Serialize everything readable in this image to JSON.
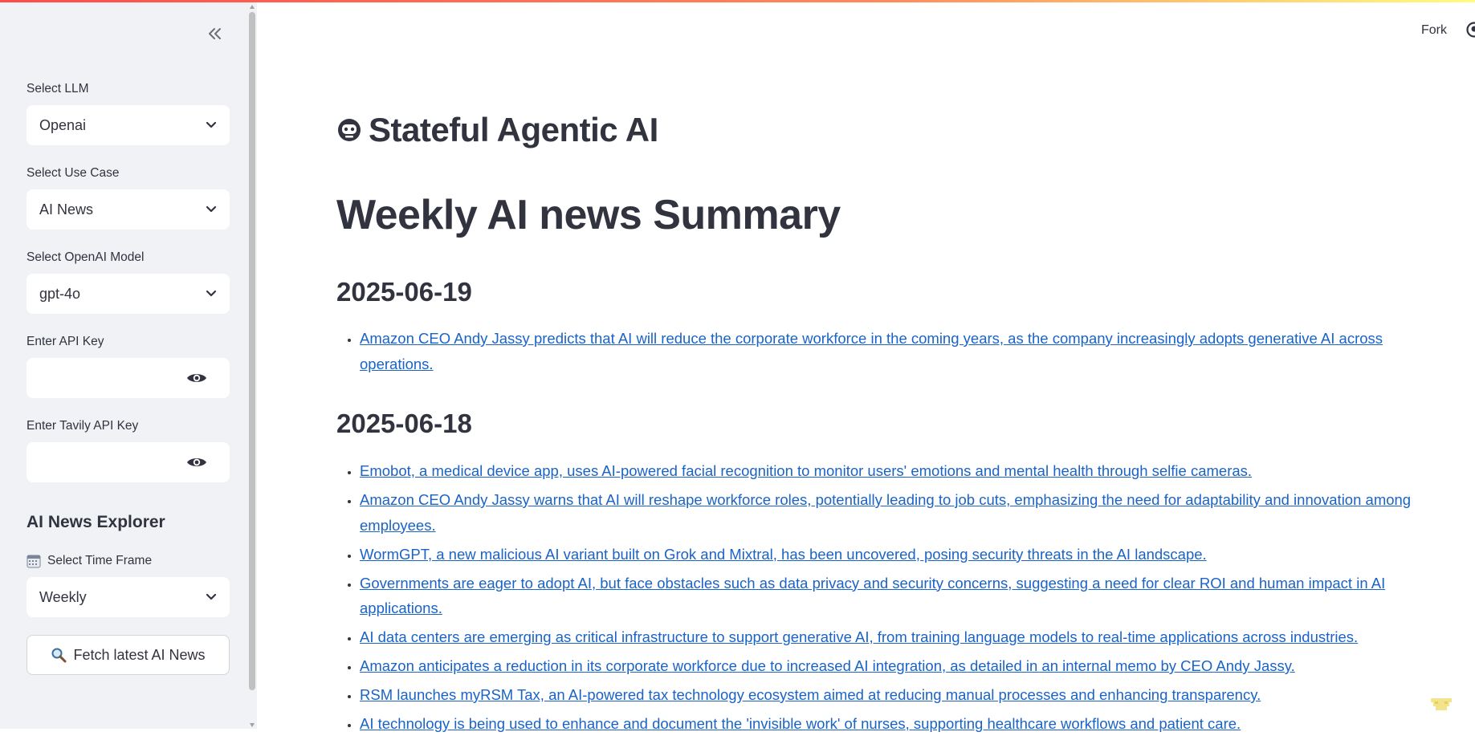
{
  "sidebar": {
    "llm": {
      "label": "Select LLM",
      "value": "Openai"
    },
    "usecase": {
      "label": "Select Use Case",
      "value": "AI News"
    },
    "model": {
      "label": "Select OpenAI Model",
      "value": "gpt-4o"
    },
    "api_key": {
      "label": "Enter API Key",
      "value": ""
    },
    "tavily_key": {
      "label": "Enter Tavily API Key",
      "value": ""
    },
    "explorer_title": "AI News Explorer",
    "time_frame": {
      "label": "Select Time Frame",
      "value": "Weekly"
    },
    "fetch_button": "Fetch latest AI News"
  },
  "header": {
    "fork_label": "Fork"
  },
  "main": {
    "app_title": "Stateful Agentic AI",
    "heading": "Weekly AI news Summary",
    "sections": [
      {
        "date": "2025-06-19",
        "items": [
          "Amazon CEO Andy Jassy predicts that AI will reduce the corporate workforce in the coming years, as the company increasingly adopts generative AI across operations."
        ]
      },
      {
        "date": "2025-06-18",
        "items": [
          "Emobot, a medical device app, uses AI-powered facial recognition to monitor users' emotions and mental health through selfie cameras.",
          "Amazon CEO Andy Jassy warns that AI will reshape workforce roles, potentially leading to job cuts, emphasizing the need for adaptability and innovation among employees.",
          "WormGPT, a new malicious AI variant built on Grok and Mixtral, has been uncovered, posing security threats in the AI landscape.",
          "Governments are eager to adopt AI, but face obstacles such as data privacy and security concerns, suggesting a need for clear ROI and human impact in AI applications.",
          "AI data centers are emerging as critical infrastructure to support generative AI, from training language models to real-time applications across industries.",
          "Amazon anticipates a reduction in its corporate workforce due to increased AI integration, as detailed in an internal memo by CEO Andy Jassy.",
          "RSM launches myRSM Tax, an AI-powered tax technology ecosystem aimed at reducing manual processes and enhancing transparency.",
          "AI technology is being used to enhance and document the 'invisible work' of nurses, supporting healthcare workflows and patient care."
        ]
      }
    ]
  },
  "colors": {
    "accent": "#ff4b4b",
    "link": "#1a63c7",
    "sidebar_bg": "#f0f2f6",
    "text": "#31333f"
  }
}
